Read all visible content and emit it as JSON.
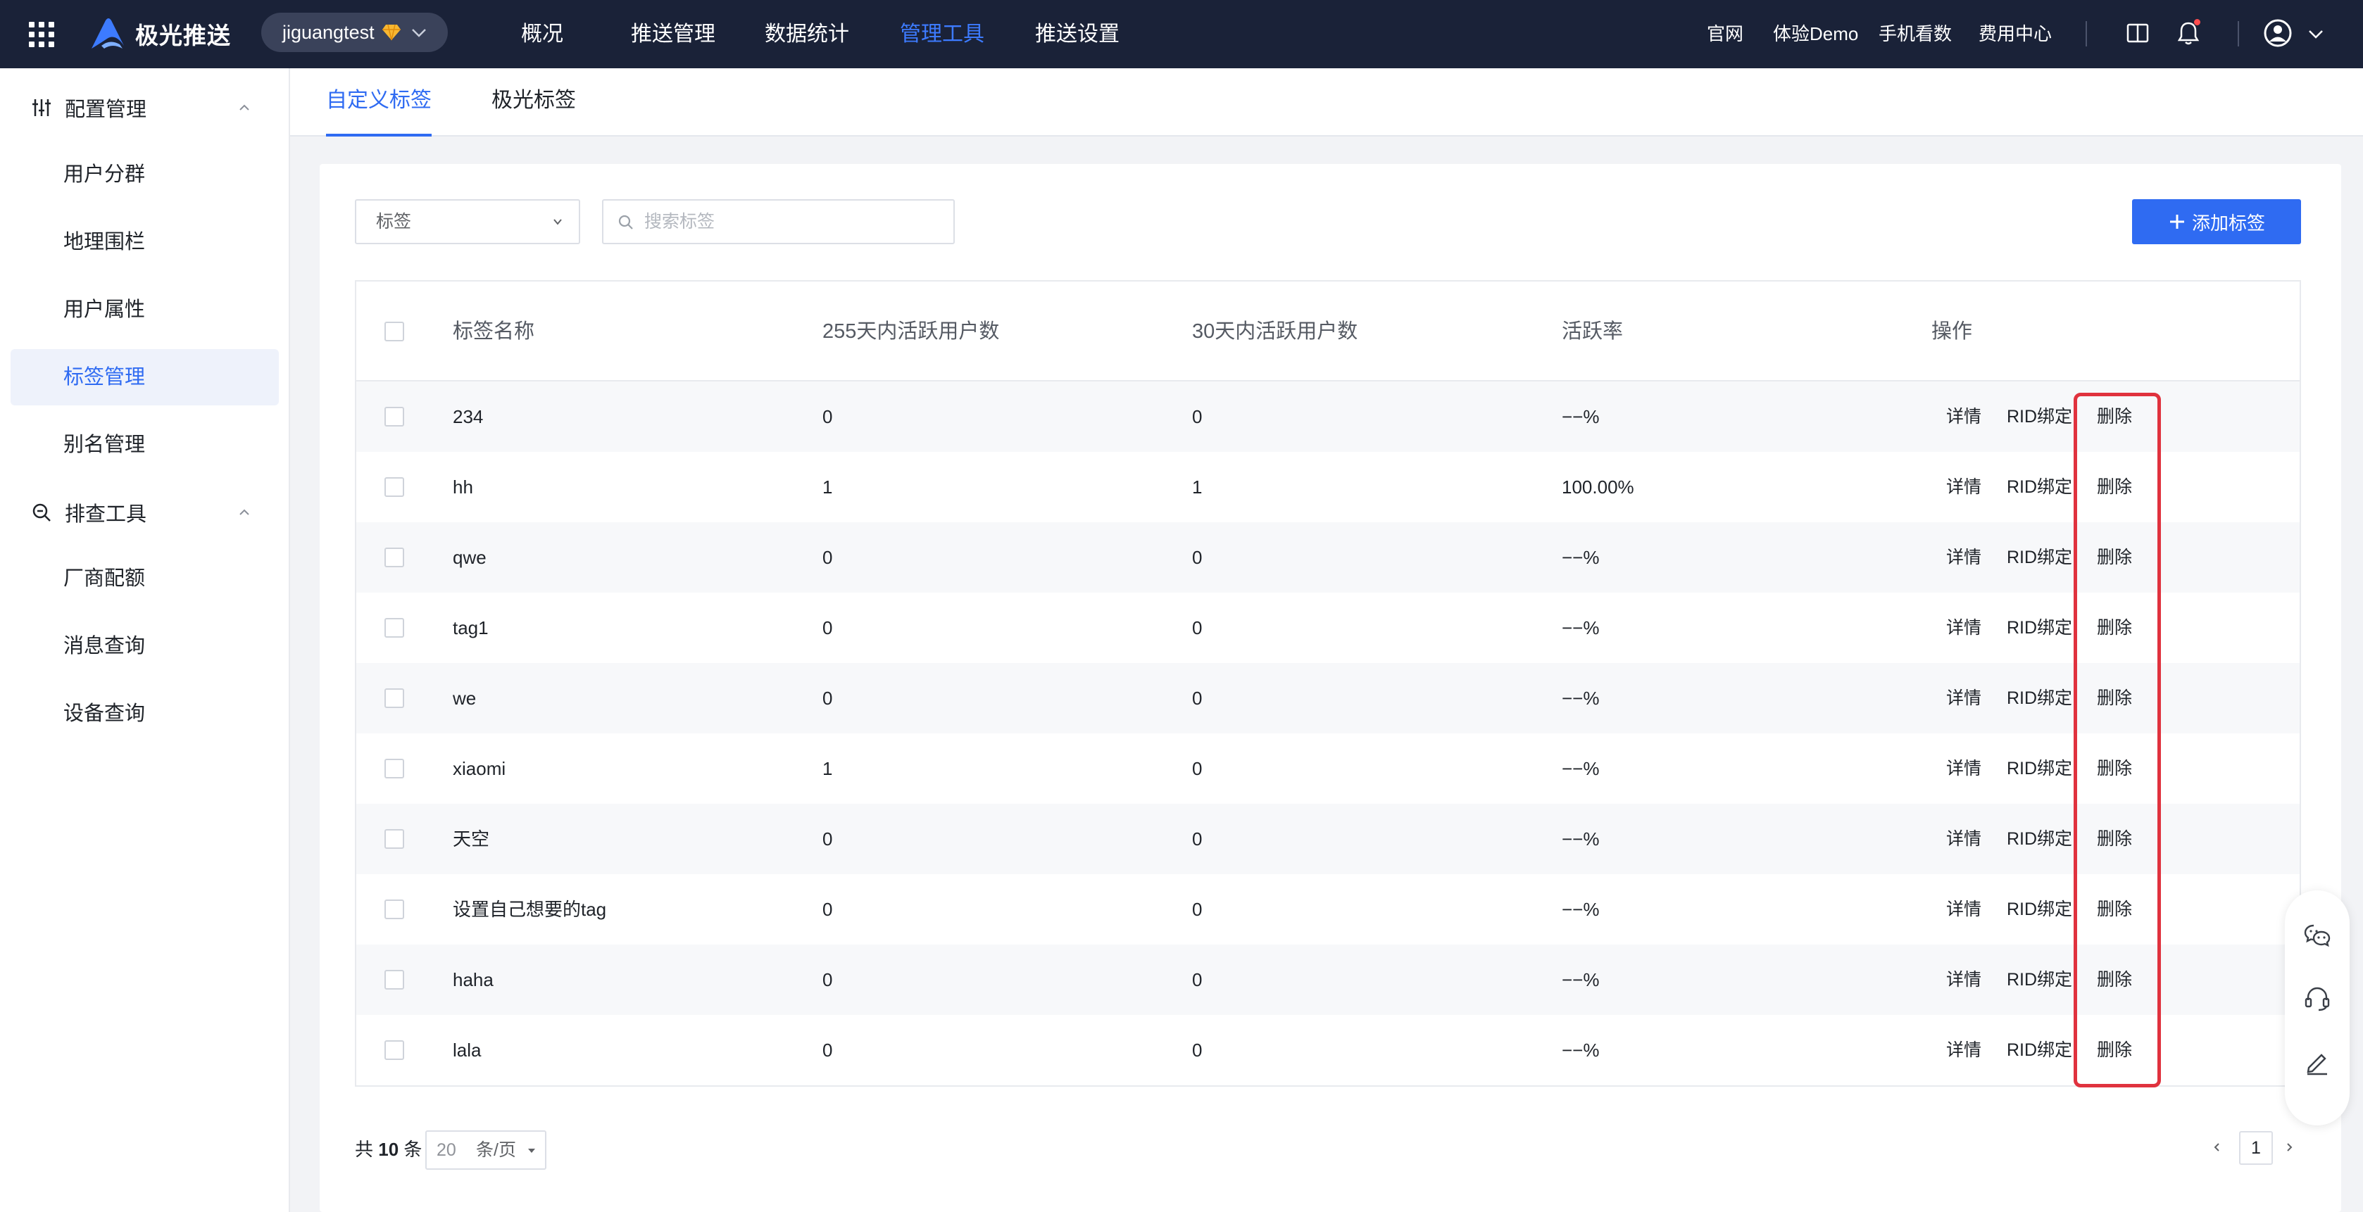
{
  "topbar": {
    "brand": "极光推送",
    "app_name": "jiguangtest",
    "nav": [
      {
        "label": "概况",
        "active": false
      },
      {
        "label": "推送管理",
        "active": false
      },
      {
        "label": "数据统计",
        "active": false
      },
      {
        "label": "管理工具",
        "active": true
      },
      {
        "label": "推送设置",
        "active": false
      }
    ],
    "links": {
      "website": "官网",
      "demo": "体验Demo",
      "mobile": "手机看数",
      "billing": "费用中心"
    }
  },
  "sidebar": {
    "groups": [
      {
        "label": "配置管理",
        "icon": "sliders-icon",
        "items": [
          {
            "label": "用户分群",
            "active": false
          },
          {
            "label": "地理围栏",
            "active": false
          },
          {
            "label": "用户属性",
            "active": false
          },
          {
            "label": "标签管理",
            "active": true
          },
          {
            "label": "别名管理",
            "active": false
          }
        ]
      },
      {
        "label": "排查工具",
        "icon": "zoom-search-icon",
        "items": [
          {
            "label": "厂商配额",
            "active": false
          },
          {
            "label": "消息查询",
            "active": false
          },
          {
            "label": "设备查询",
            "active": false
          }
        ]
      }
    ]
  },
  "tabs": [
    {
      "label": "自定义标签",
      "active": true
    },
    {
      "label": "极光标签",
      "active": false
    }
  ],
  "filters": {
    "type_select": "标签",
    "search_placeholder": "搜索标签",
    "add_button": "添加标签"
  },
  "table": {
    "columns": [
      "标签名称",
      "255天内活跃用户数",
      "30天内活跃用户数",
      "活跃率",
      "操作"
    ],
    "actions": {
      "detail": "详情",
      "rid": "RID绑定",
      "delete": "删除"
    },
    "rows": [
      {
        "name": "234",
        "active255": "0",
        "active30": "0",
        "rate": "−−%"
      },
      {
        "name": "hh",
        "active255": "1",
        "active30": "1",
        "rate": "100.00%"
      },
      {
        "name": "qwe",
        "active255": "0",
        "active30": "0",
        "rate": "−−%"
      },
      {
        "name": "tag1",
        "active255": "0",
        "active30": "0",
        "rate": "−−%"
      },
      {
        "name": "we",
        "active255": "0",
        "active30": "0",
        "rate": "−−%"
      },
      {
        "name": "xiaomi",
        "active255": "1",
        "active30": "0",
        "rate": "−−%"
      },
      {
        "name": "天空",
        "active255": "0",
        "active30": "0",
        "rate": "−−%"
      },
      {
        "name": "设置自己想要的tag",
        "active255": "0",
        "active30": "0",
        "rate": "−−%"
      },
      {
        "name": "haha",
        "active255": "0",
        "active30": "0",
        "rate": "−−%"
      },
      {
        "name": "lala",
        "active255": "0",
        "active30": "0",
        "rate": "−−%"
      }
    ]
  },
  "pagination": {
    "total_prefix": "共",
    "total": "10",
    "total_suffix": "条",
    "page_size": "20",
    "page_size_unit": "条/页",
    "current_page": "1"
  },
  "colors": {
    "topbar_bg": "#1a2238",
    "accent": "#2f6bf2",
    "highlight": "#e0323e"
  }
}
